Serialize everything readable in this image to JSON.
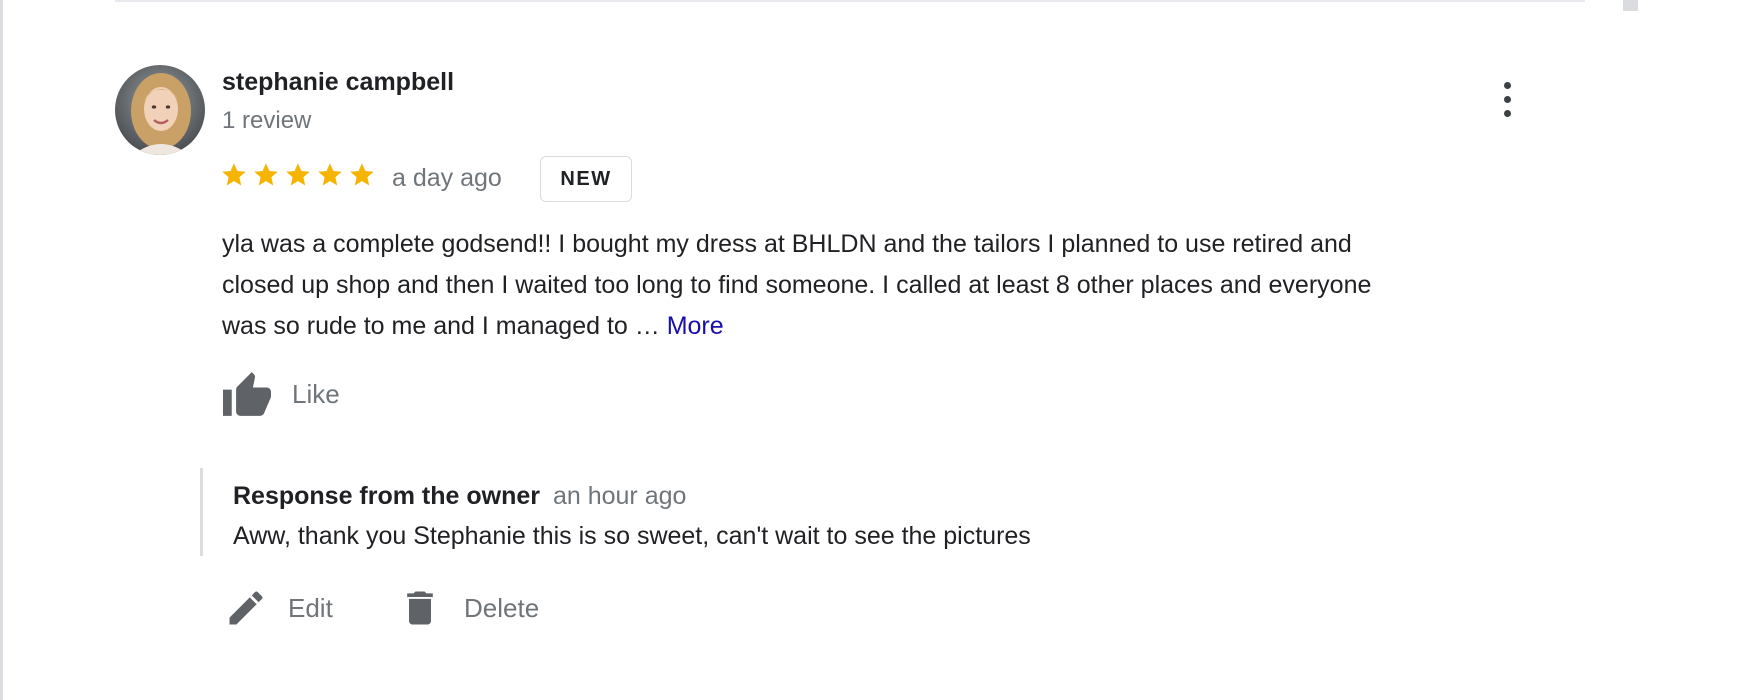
{
  "colors": {
    "star": "#f4b400",
    "link": "#1a0dab",
    "muted_text": "#70757a",
    "icon": "#5f6368"
  },
  "review": {
    "reviewer_name": "stephanie campbell",
    "review_count": "1 review",
    "rating": 5,
    "max_rating": 5,
    "timestamp": "a day ago",
    "badge": "NEW",
    "text_lines": [
      "yla was a complete godsend!! I bought my dress at BHLDN and the tailors I planned to use retired and",
      "closed up shop and then I waited too long to find someone. I called at least 8 other places and everyone",
      "was so rude to me and I managed to …"
    ],
    "more_label": "More",
    "like_label": "Like",
    "icons": {
      "avatar": "avatar-photo",
      "menu": "more-vert-icon",
      "star": "star-icon",
      "like": "thumb-up-icon"
    }
  },
  "owner_response": {
    "label": "Response from the owner",
    "timestamp": "an hour ago",
    "text": "Aww, thank you Stephanie this is so sweet, can't wait to see the pictures"
  },
  "actions": {
    "edit_label": "Edit",
    "delete_label": "Delete",
    "icons": {
      "edit": "pencil-icon",
      "delete": "trash-icon"
    }
  }
}
